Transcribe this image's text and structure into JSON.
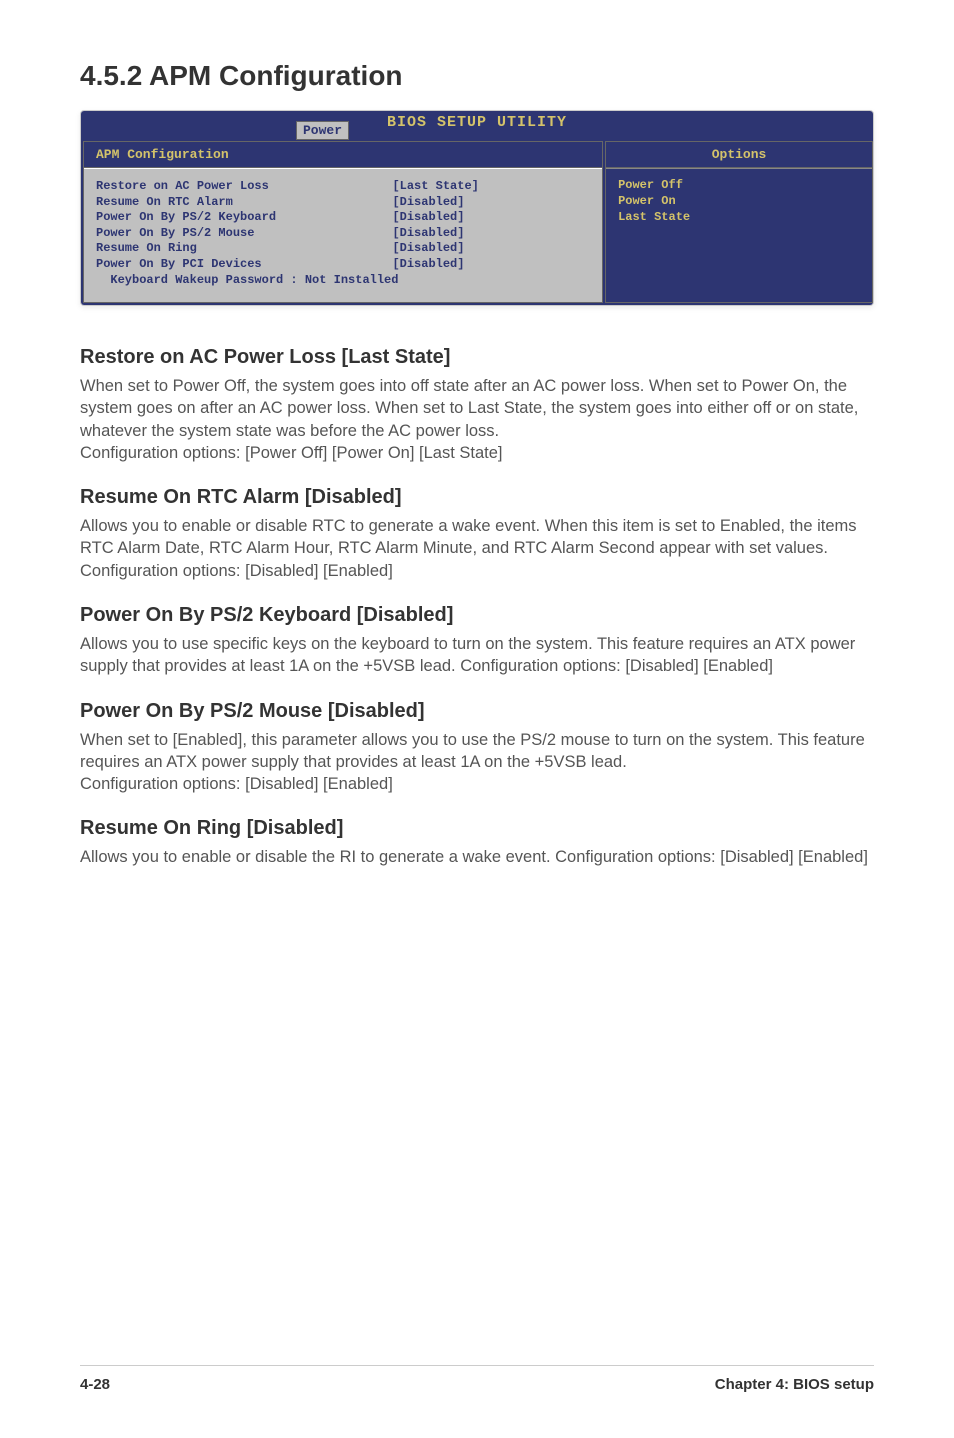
{
  "title": "4.5.2   APM Configuration",
  "bios": {
    "utility_title": "BIOS SETUP UTILITY",
    "tab": "Power",
    "panel_header": "APM Configuration",
    "rows": [
      {
        "label": "Restore on AC Power Loss",
        "value": "[Last State]"
      },
      {
        "label": "Resume On RTC Alarm",
        "value": "[Disabled]"
      },
      {
        "label": "Power On By PS/2 Keyboard",
        "value": "[Disabled]"
      },
      {
        "label": "Power On By PS/2 Mouse",
        "value": "[Disabled]"
      },
      {
        "label": "Resume On Ring",
        "value": "[Disabled]"
      },
      {
        "label": "Power On By PCI Devices",
        "value": "[Disabled]"
      }
    ],
    "last_row": "  Keyboard Wakeup Password : Not Installed",
    "options_header": "Options",
    "options": [
      "Power Off",
      "Power On",
      "Last State"
    ]
  },
  "settings": [
    {
      "head": "Restore on AC Power Loss [Last State]",
      "body": "When set to Power Off, the system goes into off state after an AC power loss. When set to Power On, the system goes on after an AC power loss. When set to Last State, the system goes into either off or on state, whatever the system state was before the AC power loss.\nConfiguration options: [Power Off] [Power On] [Last State]"
    },
    {
      "head": "Resume On RTC Alarm [Disabled]",
      "body": "Allows you to enable or disable RTC to generate a wake event. When this item is set to Enabled, the items RTC Alarm Date, RTC Alarm Hour, RTC Alarm Minute, and RTC Alarm Second appear with set values. Configuration options: [Disabled] [Enabled]"
    },
    {
      "head": "Power On By PS/2 Keyboard [Disabled]",
      "body": "Allows you to use specific keys on the keyboard to turn on the system. This feature requires an ATX power supply that provides at least 1A on the +5VSB lead. Configuration options: [Disabled] [Enabled]"
    },
    {
      "head": "Power On By PS/2 Mouse [Disabled]",
      "body": "When set to [Enabled], this parameter allows you to use the PS/2 mouse to turn on the system. This feature requires an ATX power supply that provides at least 1A on the +5VSB lead.\nConfiguration options: [Disabled] [Enabled]"
    },
    {
      "head": "Resume On Ring [Disabled]",
      "body": "Allows you to enable or disable the RI to generate a wake event. Configuration options: [Disabled] [Enabled]"
    }
  ],
  "footer": {
    "left": "4-28",
    "right": "Chapter 4: BIOS setup"
  }
}
